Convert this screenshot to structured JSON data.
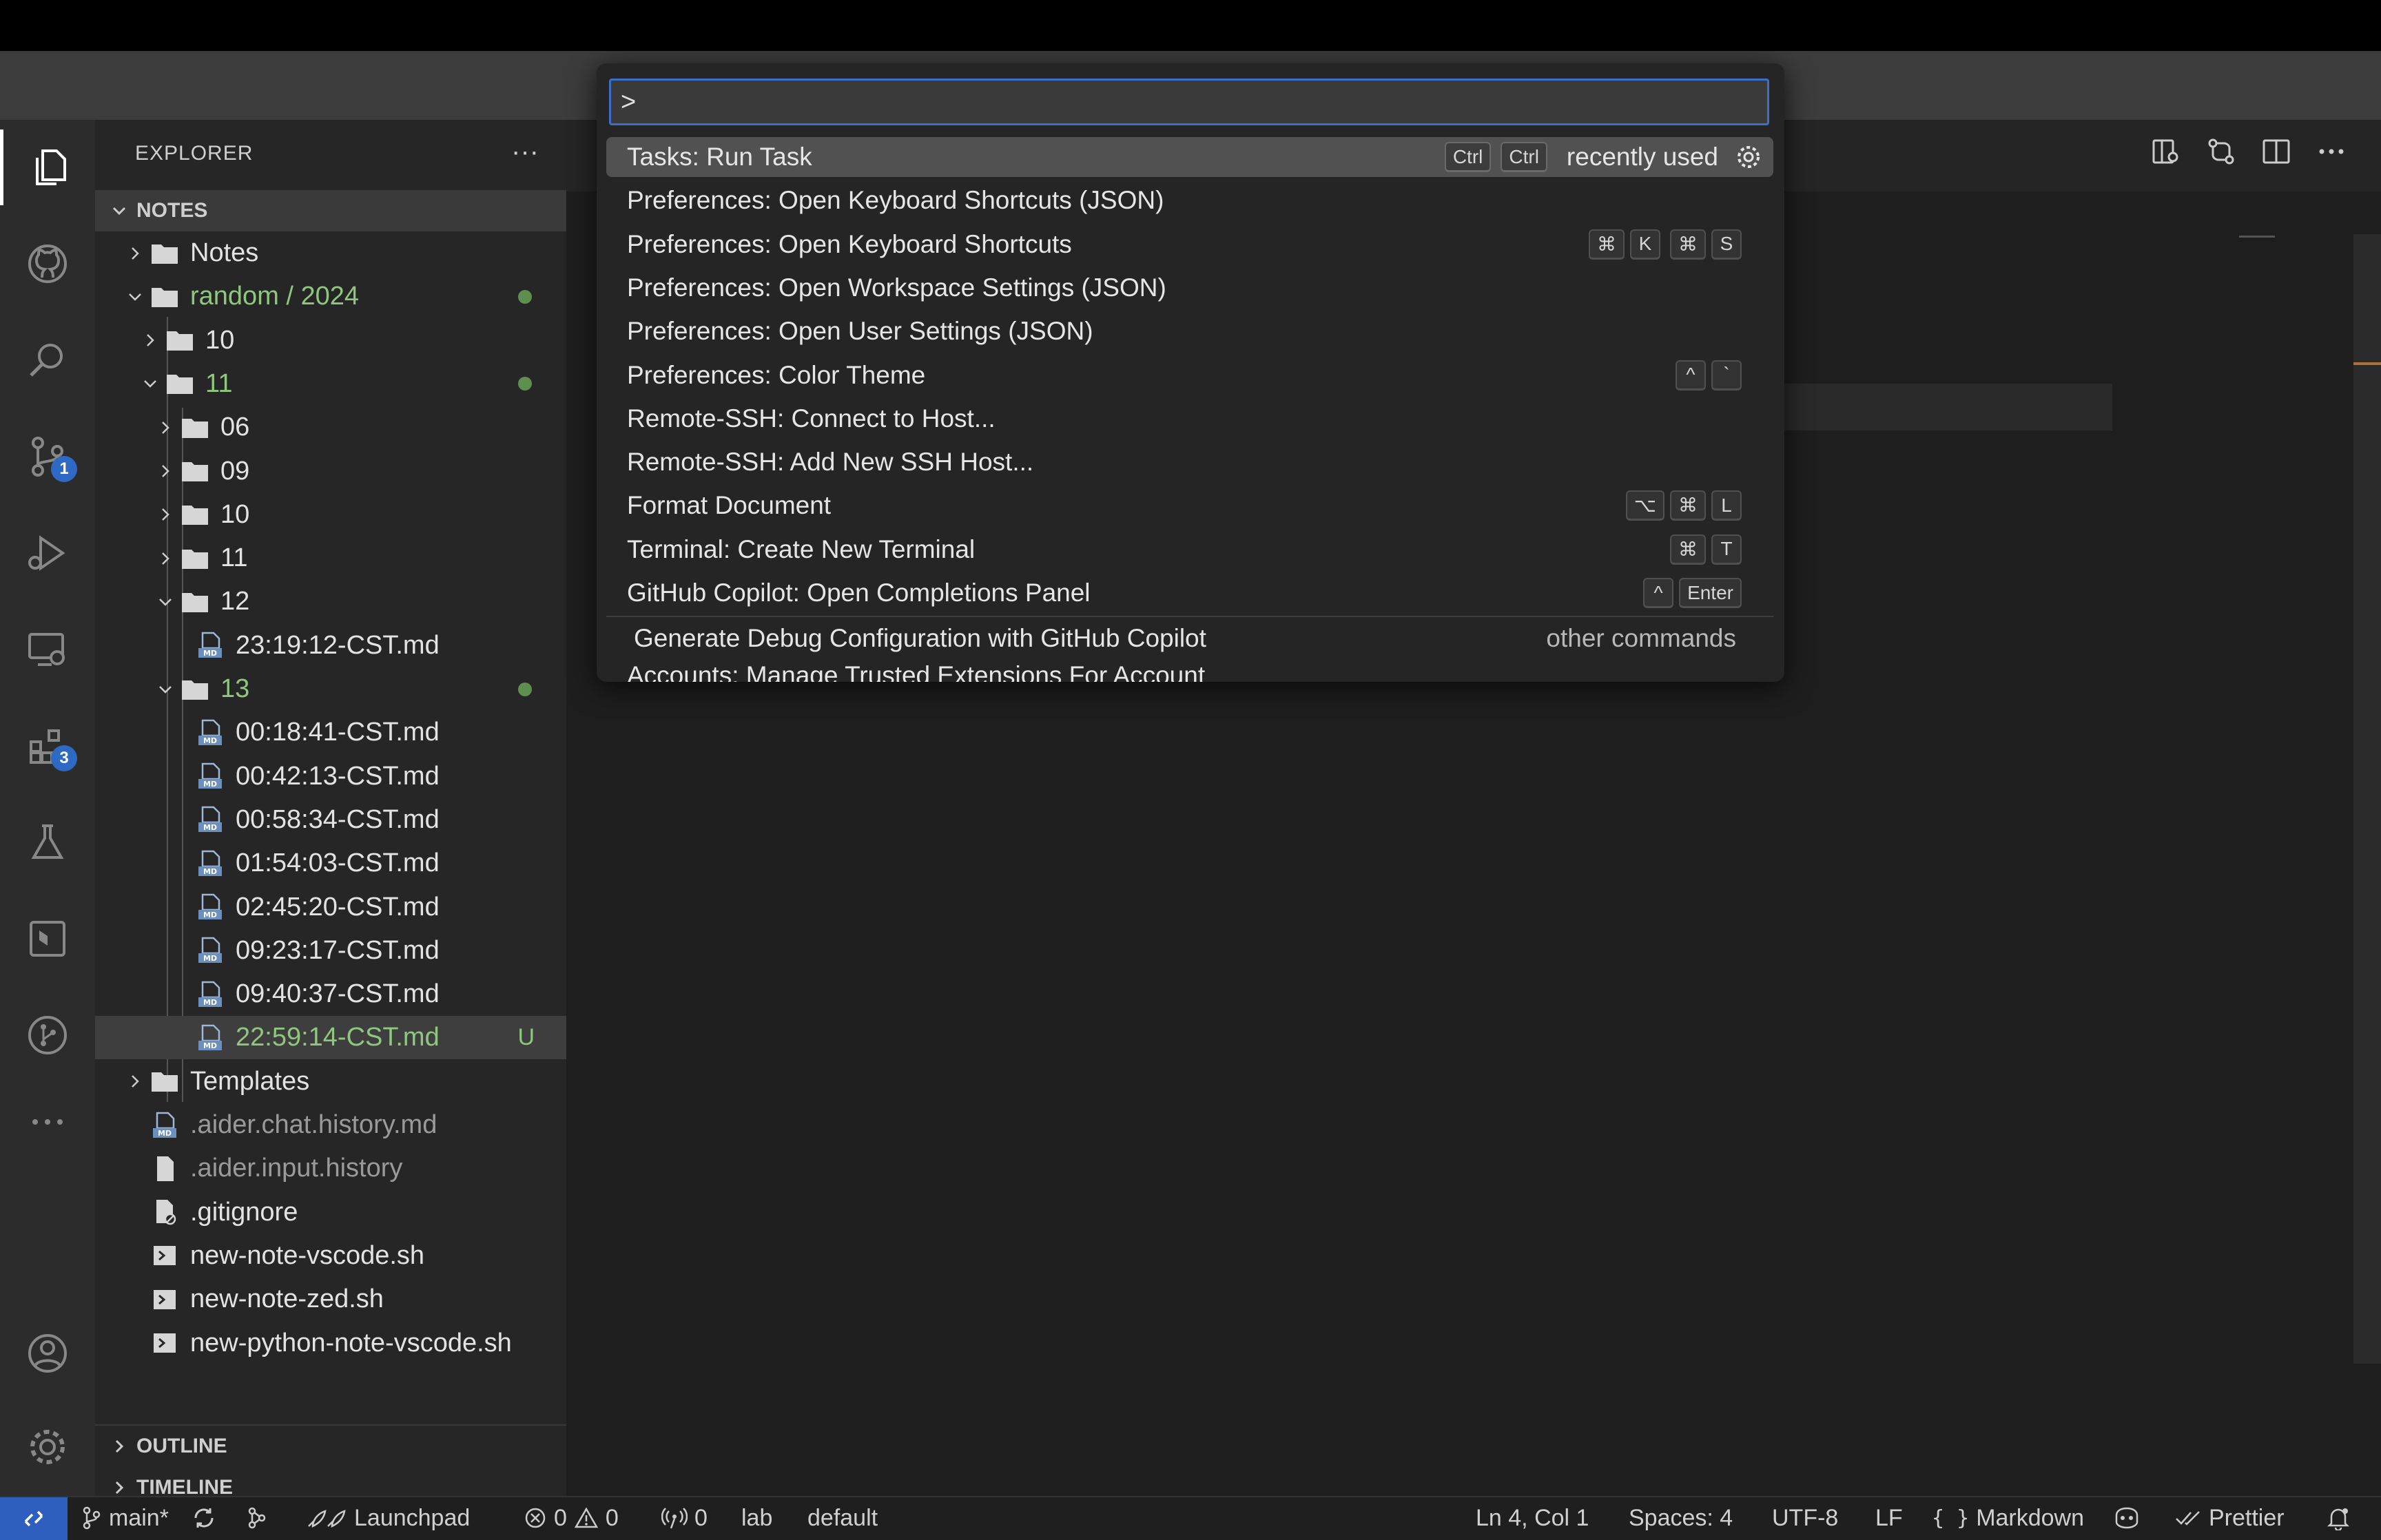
{
  "explorer": {
    "title": "EXPLORER",
    "more": "···",
    "section": "NOTES",
    "tree": [
      {
        "label": "Notes",
        "type": "folder",
        "state": "collapsed",
        "depth": 0
      },
      {
        "label": "random / 2024",
        "type": "folder",
        "state": "expanded",
        "depth": 0,
        "status": "modified-dot"
      },
      {
        "label": "10",
        "type": "folder",
        "state": "collapsed",
        "depth": 1
      },
      {
        "label": "11",
        "type": "folder",
        "state": "expanded",
        "depth": 1,
        "status": "modified-dot"
      },
      {
        "label": "06",
        "type": "folder",
        "state": "collapsed",
        "depth": 2
      },
      {
        "label": "09",
        "type": "folder",
        "state": "collapsed",
        "depth": 2
      },
      {
        "label": "10",
        "type": "folder",
        "state": "collapsed",
        "depth": 2
      },
      {
        "label": "11",
        "type": "folder",
        "state": "collapsed",
        "depth": 2
      },
      {
        "label": "12",
        "type": "folder",
        "state": "expanded",
        "depth": 2
      },
      {
        "label": "23:19:12-CST.md",
        "type": "md",
        "depth": 3
      },
      {
        "label": "13",
        "type": "folder",
        "state": "expanded",
        "depth": 2,
        "status": "modified-dot"
      },
      {
        "label": "00:18:41-CST.md",
        "type": "md",
        "depth": 3
      },
      {
        "label": "00:42:13-CST.md",
        "type": "md",
        "depth": 3
      },
      {
        "label": "00:58:34-CST.md",
        "type": "md",
        "depth": 3
      },
      {
        "label": "01:54:03-CST.md",
        "type": "md",
        "depth": 3
      },
      {
        "label": "02:45:20-CST.md",
        "type": "md",
        "depth": 3
      },
      {
        "label": "09:23:17-CST.md",
        "type": "md",
        "depth": 3
      },
      {
        "label": "09:40:37-CST.md",
        "type": "md",
        "depth": 3
      },
      {
        "label": "22:59:14-CST.md",
        "type": "md",
        "depth": 3,
        "status": "U"
      },
      {
        "label": "Templates",
        "type": "folder",
        "state": "collapsed",
        "depth": 0
      },
      {
        "label": ".aider.chat.history.md",
        "type": "md",
        "depth": 0
      },
      {
        "label": ".aider.input.history",
        "type": "file",
        "depth": 0
      },
      {
        "label": ".gitignore",
        "type": "gitignore",
        "depth": 0
      },
      {
        "label": "new-note-vscode.sh",
        "type": "sh",
        "depth": 0
      },
      {
        "label": "new-note-zed.sh",
        "type": "sh",
        "depth": 0
      },
      {
        "label": "new-python-note-vscode.sh",
        "type": "sh",
        "depth": 0
      }
    ],
    "outline": "OUTLINE",
    "timeline": "TIMELINE"
  },
  "activity_bar": {
    "badges": {
      "source_control": "1",
      "extensions": "3"
    }
  },
  "command_palette": {
    "input_value": ">",
    "items": [
      {
        "label": "Tasks: Run Task",
        "keys": [
          [
            "Ctrl"
          ],
          [
            "Ctrl"
          ]
        ],
        "note": "recently used"
      },
      {
        "label": "Preferences: Open Keyboard Shortcuts (JSON)",
        "keys": []
      },
      {
        "label": "Preferences: Open Keyboard Shortcuts",
        "keys": [
          [
            "⌘",
            "K"
          ],
          [
            "⌘",
            "S"
          ]
        ]
      },
      {
        "label": "Preferences: Open Workspace Settings (JSON)",
        "keys": []
      },
      {
        "label": "Preferences: Open User Settings (JSON)",
        "keys": []
      },
      {
        "label": "Preferences: Color Theme",
        "keys": [
          [
            "^",
            "`"
          ]
        ]
      },
      {
        "label": "Remote-SSH: Connect to Host...",
        "keys": []
      },
      {
        "label": "Remote-SSH: Add New SSH Host...",
        "keys": []
      },
      {
        "label": "Format Document",
        "keys": [
          [
            "⌥",
            "⌘",
            "L"
          ]
        ]
      },
      {
        "label": "Terminal: Create New Terminal",
        "keys": [
          [
            "⌘",
            "T"
          ]
        ]
      },
      {
        "label": "GitHub Copilot: Open Completions Panel",
        "keys": [
          [
            "^",
            "Enter"
          ]
        ]
      }
    ],
    "other_item": {
      "label": "Generate Debug Configuration with GitHub Copilot",
      "note": "other commands"
    },
    "cutoff_item": "Accounts: Manage Trusted Extensions For Account"
  },
  "status_bar": {
    "branch": "main*",
    "launchpad": "Launchpad",
    "errors": "0",
    "warnings": "0",
    "ports": "0",
    "host": "lab",
    "profile": "default",
    "position": "Ln 4, Col 1",
    "spaces": "Spaces: 4",
    "encoding": "UTF-8",
    "eol": "LF",
    "language": "Markdown",
    "formatter": "Prettier"
  },
  "colors": {
    "accent": "#2e5fc0",
    "git_green": "#8fc77f",
    "selection": "#515151"
  }
}
